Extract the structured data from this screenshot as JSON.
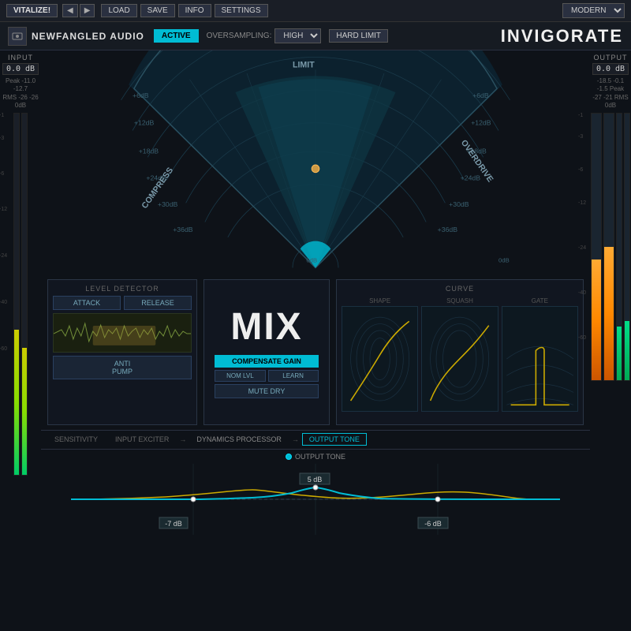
{
  "topbar": {
    "vitalize": "VITALIZE!",
    "load": "LOAD",
    "save": "SAVE",
    "info": "INFO",
    "settings": "SETTINGS",
    "preset": "MODERN"
  },
  "header": {
    "brand": "NEWFANGLED AUDIO",
    "active": "ACTIVE",
    "oversampling_label": "OVERSAMPLING:",
    "oversampling_value": "HIGH",
    "hard_limit": "HARD LIMIT",
    "title": "INVIGORATE"
  },
  "input": {
    "label": "INPUT",
    "readout": "0.0 dB",
    "peak": "Peak -11.0 -12.7",
    "rms": "RMS -26 -26",
    "zero": "0dB",
    "scale": [
      "-1",
      "-3",
      "-6",
      "-12",
      "-24",
      "-40",
      "-60"
    ]
  },
  "output": {
    "label": "OUTPUT",
    "readout": "0.0 dB",
    "peak": "-18.5 -0.1 -1.5 Peak",
    "rms": "-27 -21 RMS",
    "zero": "0dB",
    "scale": [
      "-1",
      "-3",
      "-6",
      "-12",
      "-24",
      "-40",
      "-60"
    ]
  },
  "fan": {
    "left_label": "COMPRESS",
    "right_label": "OVERDRIVE",
    "top_label": "LIMIT",
    "db_labels": [
      "+36dB",
      "+30dB",
      "+24dB",
      "+18dB",
      "+12dB",
      "+6dB",
      "0dB"
    ]
  },
  "level_detector": {
    "title": "LEVEL DETECTOR",
    "attack": "ATTACK",
    "release": "RELEASE",
    "anti_pump": "ANTI\nPUMP"
  },
  "mix": {
    "label": "MIX",
    "compensate": "COMPENSATE GAIN",
    "nom_lvl": "NOM LVL",
    "learn": "LEARN",
    "mute_dry": "MUTE DRY"
  },
  "curve": {
    "title": "CURVE",
    "shape": "SHAPE",
    "squash": "SQUASH",
    "gate": "GATE"
  },
  "tabs": {
    "sensitivity": "SENSITIVITY",
    "input_exciter": "INPUT EXCITER",
    "dynamics": "→DYNAMICS PROCESSOR→",
    "output_tone": "OUTPUT TONE"
  },
  "output_tone": {
    "label": "OUTPUT TONE",
    "db_7": "-7 dB",
    "db_5": "5 dB",
    "db_6": "-6 dB"
  }
}
